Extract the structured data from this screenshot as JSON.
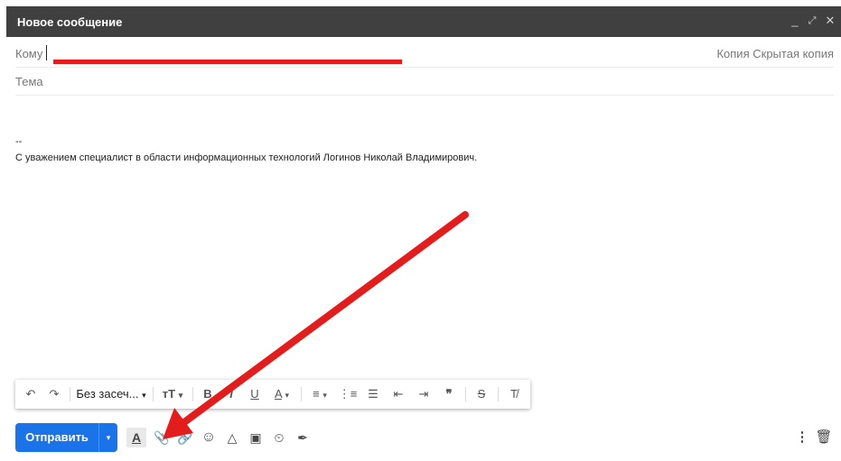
{
  "window": {
    "title": "Новое сообщение",
    "controls": {
      "minimize": "_",
      "fullscreen": "⤢",
      "close": "✕"
    }
  },
  "compose": {
    "to_label": "Кому",
    "cc_label": "Копия",
    "bcc_label": "Скрытая копия",
    "subject_placeholder": "Тема"
  },
  "body": {
    "signature_dash": "--",
    "signature_text": "С уважением специалист в области информационных технологий Логинов Николай Владимирович."
  },
  "format_toolbar": {
    "undo": "↶",
    "redo": "↷",
    "font": "Без засеч...",
    "dropdown": "▾",
    "font_size": "тT",
    "bold": "B",
    "italic": "I",
    "underline": "U",
    "text_color": "A",
    "align": "≡",
    "numbered_list": "⋮≡",
    "bulleted_list": "☰",
    "indent_less": "⇤",
    "indent_more": "⇥",
    "quote": "❞",
    "strikethrough": "S",
    "clear_format": "T̸"
  },
  "bottom_toolbar": {
    "send_label": "Отправить",
    "send_menu": "▾",
    "formatting_options": "A",
    "attach": "📎",
    "link": "🔗",
    "emoji": "☺",
    "drive": "△",
    "photo": "▣",
    "confidential": "⏲",
    "signature": "✒",
    "more": "⋮",
    "discard": "🗑"
  },
  "annotation_colors": {
    "red": "#e51c1c"
  }
}
